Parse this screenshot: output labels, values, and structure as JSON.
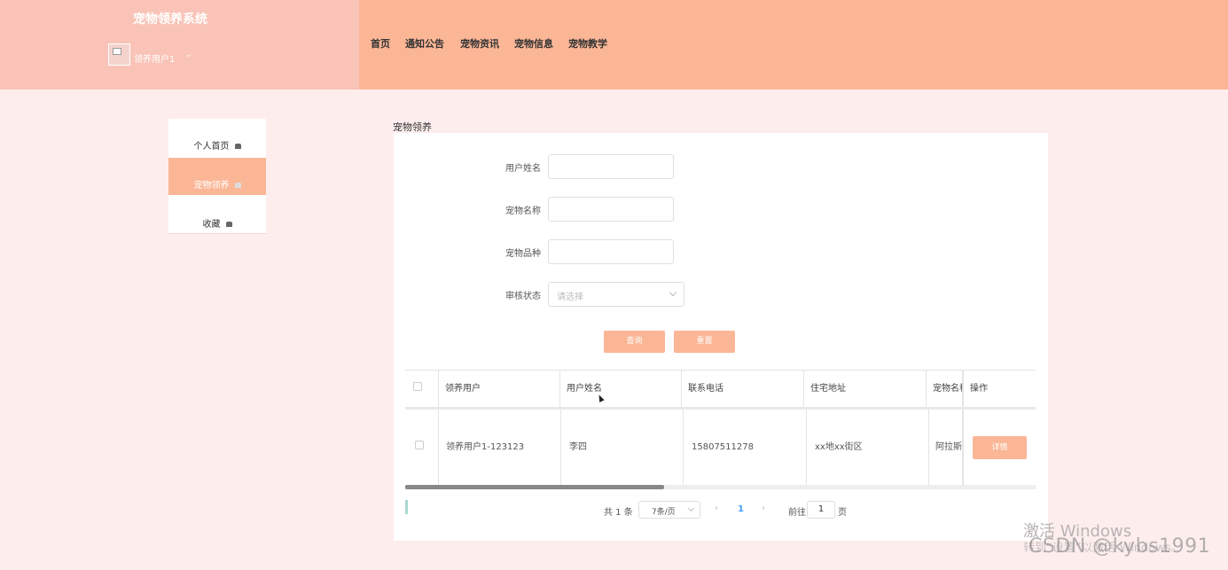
{
  "header": {
    "title": "宠物领养系统",
    "user": {
      "name": "领养用户1",
      "caret": "⌄"
    },
    "nav": [
      "首页",
      "通知公告",
      "宠物资讯",
      "宠物信息",
      "宠物教学"
    ]
  },
  "sidebar": {
    "items": [
      {
        "label": "个人首页",
        "icon": "home-icon"
      },
      {
        "label": "宠物领养",
        "icon": "home-icon",
        "active": true
      },
      {
        "label": "收藏",
        "icon": "home-icon"
      }
    ]
  },
  "breadcrumb": "宠物领养",
  "search": {
    "fields": [
      {
        "label": "用户姓名",
        "value": ""
      },
      {
        "label": "宠物名称",
        "value": ""
      },
      {
        "label": "宠物品种",
        "value": ""
      }
    ],
    "status": {
      "label": "审核状态",
      "placeholder": "请选择"
    },
    "query_label": "查询",
    "reset_label": "重置"
  },
  "table": {
    "columns": [
      "领养用户",
      "用户姓名",
      "联系电话",
      "住宅地址",
      "宠物名称",
      "操作"
    ],
    "rows": [
      {
        "cells": [
          "领养用户1-123123",
          "李四",
          "15807511278",
          "xx地xx街区",
          "阿拉斯"
        ],
        "action": "详情"
      }
    ],
    "horizontal_scroll_fraction": 0.41
  },
  "pagination": {
    "total": "共 1 条",
    "page_size": "7条/页",
    "prev": "‹",
    "current": "1",
    "next": "›",
    "goto_prefix": "前往",
    "goto_value": "1",
    "goto_suffix": "页"
  },
  "watermark": {
    "activate": "激活 Windows",
    "activate_sub": "转到“设置”以激活 Windows。",
    "csdn": "CSDN @kybs1991"
  },
  "colors": {
    "accent": "#fbb696",
    "brand_bg": "#f9c3b7",
    "page_bg": "#fdeeed",
    "pager_active": "#409eff"
  }
}
